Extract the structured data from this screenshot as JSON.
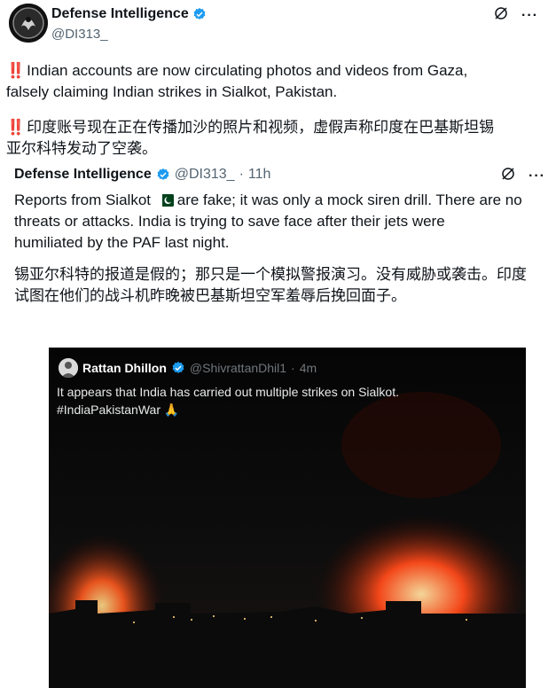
{
  "tweet": {
    "author_name": "Defense Intelligence",
    "author_handle": "@DI313_",
    "emphasis_mark": "‼️",
    "text_en_line1": "Indian accounts are now circulating photos and videos from Gaza,",
    "text_en_line2": "falsely claiming  Indian strikes in Sialkot, Pakistan.",
    "text_zh_line1": "印度账号现在正在传播加沙的照片和视频，虚假声称印度在巴基斯坦锡",
    "text_zh_line2": "亚尔科特发动了空袭。",
    "icons": [
      "grok-icon",
      "more-icon"
    ]
  },
  "quoted": {
    "author_name": "Defense Intelligence",
    "author_handle": "@DI313_",
    "separator": "·",
    "time": "11h",
    "text_part1": "Reports from Sialkot",
    "text_part2": "are fake; it was only a mock siren drill. There are no",
    "text_line2": "threats or attacks. India is trying to save face after their jets were",
    "text_line3": "humiliated by the PAF last night.",
    "text_zh_line1": "锡亚尔科特的报道是假的；那只是一个模拟警报演习。没有威胁或袭击。印度",
    "text_zh_line2": "试图在他们的战斗机昨晚被巴基斯坦空军羞辱后挽回面子。",
    "flag": "pakistan-flag"
  },
  "media": {
    "author_name": "Rattan Dhillon",
    "author_handle": "@ShivrattanDhil1",
    "separator": "·",
    "time": "4m",
    "text_line1": "It appears that India has carried out multiple strikes on Sialkot.",
    "text_line2": "#IndiaPakistanWar",
    "emoji": "🙏",
    "image_description_icon": "night-fire-photo"
  },
  "colors": {
    "verified": "#1d9bf0",
    "emphasis": "#c8102e",
    "handle": "#536471",
    "fire": "#ff4a1a"
  }
}
